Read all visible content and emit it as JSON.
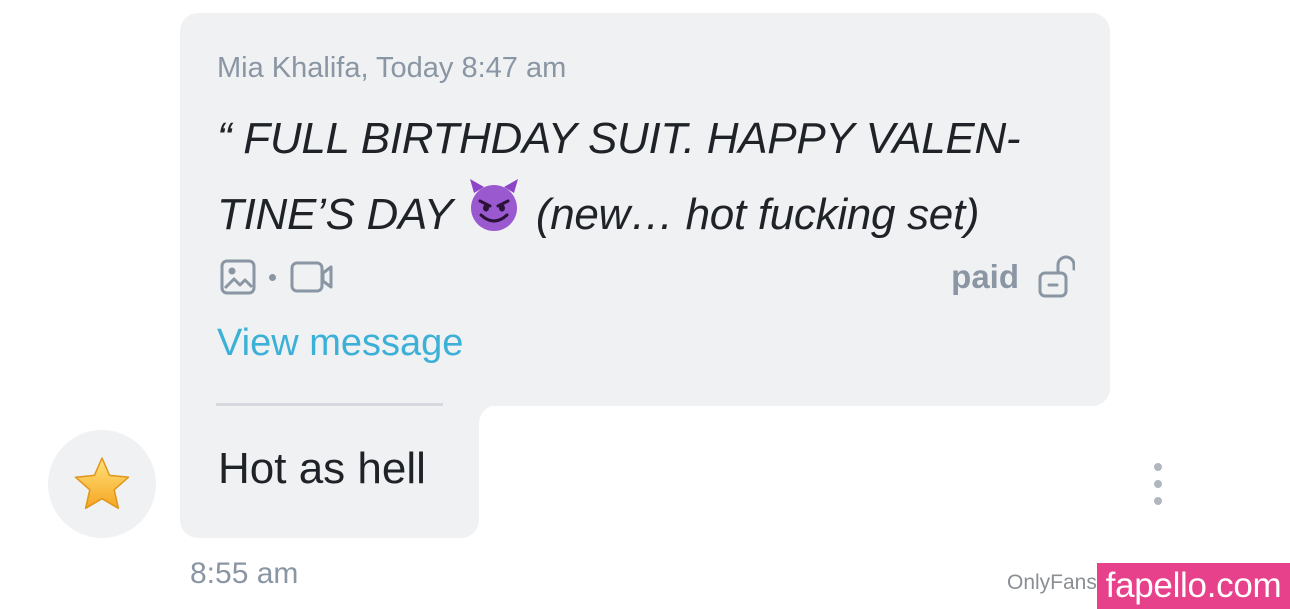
{
  "quoted_message": {
    "meta": "Mia Khalifa, Today 8:47 am",
    "text_before_emoji": "“ FULL BIRTHDAY SUIT. HAPPY VALEN-TINE’S DAY",
    "emoji": "smiling-devil-emoji",
    "text_after_emoji": " (new… hot fucking set)",
    "media_icons": [
      "image-icon",
      "video-icon"
    ],
    "paid_label": "paid",
    "paid_icon": "unlocked-padlock-icon",
    "view_link": "View message"
  },
  "reply": {
    "text": "Hot as hell",
    "time": "8:55 am",
    "avatar_icon": "star-icon"
  },
  "watermarks": {
    "onlyfans": "OnlyFans",
    "fapello": "fapello.com"
  },
  "colors": {
    "bubble_bg": "#eff1f3",
    "meta_gray": "#8a96a3",
    "link_blue": "#3cb0d6",
    "text_dark": "#1f2328",
    "watermark_pink": "#e8418c"
  }
}
